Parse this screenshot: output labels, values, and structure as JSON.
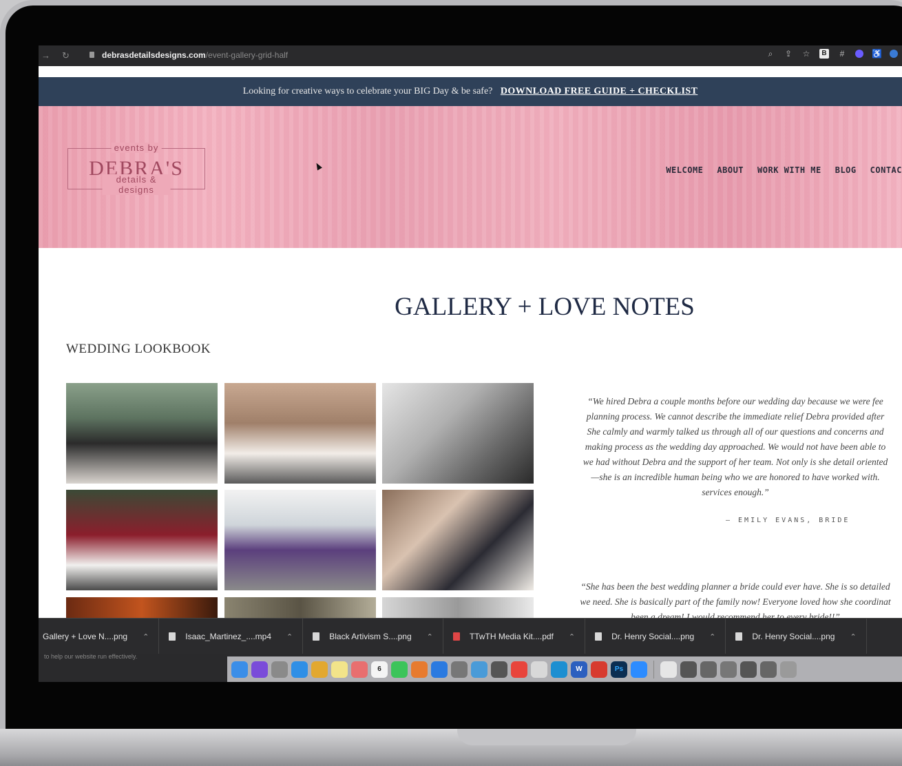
{
  "browser": {
    "url_domain": "debrasdetailsdesigns.com",
    "url_path": "/event-gallery-grid-half",
    "toolbar_icons": [
      "search-icon",
      "share-icon",
      "star-icon",
      "b-extension-icon",
      "hash-extension-icon",
      "purple-extension-icon",
      "accessibility-icon",
      "blue-extension-icon"
    ],
    "b_label": "B",
    "hash_label": "#"
  },
  "announcement": {
    "text": "Looking for creative ways to celebrate your BIG Day & be safe?",
    "link": "DOWNLOAD FREE GUIDE + CHECKLIST"
  },
  "logo": {
    "top": "events by",
    "main": "DEBRA'S",
    "bottom": "details & designs"
  },
  "nav": [
    "WELCOME",
    "ABOUT",
    "WORK WITH ME",
    "BLOG",
    "CONTAC"
  ],
  "page": {
    "title": "GALLERY + LOVE NOTES",
    "section": "WEDDING LOOKBOOK"
  },
  "testimonials": [
    {
      "lines": [
        "“We hired Debra a couple months before our wedding day because we were fee",
        "planning process. We cannot describe the immediate relief Debra provided after",
        "She calmly and warmly talked us through all of our questions and concerns and",
        "making process as the wedding day approached. We would not have been able to",
        "we had without Debra and the support of her team. Not only is she detail oriented",
        "—she is an incredible human being who we are honored to have worked with.",
        "services enough.”"
      ],
      "author": "— EMILY EVANS, BRIDE"
    },
    {
      "lines": [
        "“She has been the best wedding planner a bride could ever have. She is so detailed",
        "we need. She is basically part of the family now! Everyone loved how she coordinat",
        "been a dream! I would recommend her to every bride!!”"
      ]
    }
  ],
  "downloads": [
    {
      "name": "Gallery + Love N....png",
      "type": "image"
    },
    {
      "name": "Isaac_Martinez_....mp4",
      "type": "video"
    },
    {
      "name": "Black Artivism S....png",
      "type": "image"
    },
    {
      "name": "TTwTH Media Kit....pdf",
      "type": "pdf"
    },
    {
      "name": "Dr. Henry Social....png",
      "type": "image"
    },
    {
      "name": "Dr. Henry Social....png",
      "type": "image"
    }
  ],
  "footer_snippet": "to help our website run effectively.",
  "dock_apps": [
    {
      "name": "finder-icon",
      "color": "#3b8ee8"
    },
    {
      "name": "siri-icon",
      "color": "#7a4cd9"
    },
    {
      "name": "launchpad-icon",
      "color": "#8a8a8a"
    },
    {
      "name": "safari-icon",
      "color": "#2f8fe6"
    },
    {
      "name": "notes-icon",
      "color": "#e2a830"
    },
    {
      "name": "stickies-icon",
      "color": "#f2e48a"
    },
    {
      "name": "photos-icon",
      "color": "#e86f6f"
    },
    {
      "name": "calendar-icon",
      "color": "#f4f4f4"
    },
    {
      "name": "facetime-icon",
      "color": "#3cc45a"
    },
    {
      "name": "books-icon",
      "color": "#e77b2f"
    },
    {
      "name": "appstore-icon",
      "color": "#2b7ae0"
    },
    {
      "name": "system-preferences-icon",
      "color": "#777"
    },
    {
      "name": "font-book-icon",
      "color": "#4a9bd8"
    },
    {
      "name": "preview-icon",
      "color": "#555"
    },
    {
      "name": "chrome-icon",
      "color": "#e8453c"
    },
    {
      "name": "acrobat-icon",
      "color": "#d8d8d8"
    },
    {
      "name": "edge-icon",
      "color": "#1d8fd1"
    },
    {
      "name": "word-icon",
      "color": "#2b5fbf"
    },
    {
      "name": "acrobat-reader-icon",
      "color": "#d73b2f"
    },
    {
      "name": "photoshop-icon",
      "color": "#0b2e52"
    },
    {
      "name": "zoom-icon",
      "color": "#2d8cff"
    },
    {
      "name": "file-icon",
      "color": "#e6e6e6"
    },
    {
      "name": "window-thumb-1-icon",
      "color": "#555"
    },
    {
      "name": "window-thumb-2-icon",
      "color": "#666"
    },
    {
      "name": "window-thumb-3-icon",
      "color": "#777"
    },
    {
      "name": "window-thumb-4-icon",
      "color": "#555"
    },
    {
      "name": "window-thumb-5-icon",
      "color": "#666"
    },
    {
      "name": "trash-icon",
      "color": "#9a9a9a"
    }
  ],
  "dock_labels": {
    "calendar": "6",
    "word": "W",
    "photoshop": "Ps"
  }
}
